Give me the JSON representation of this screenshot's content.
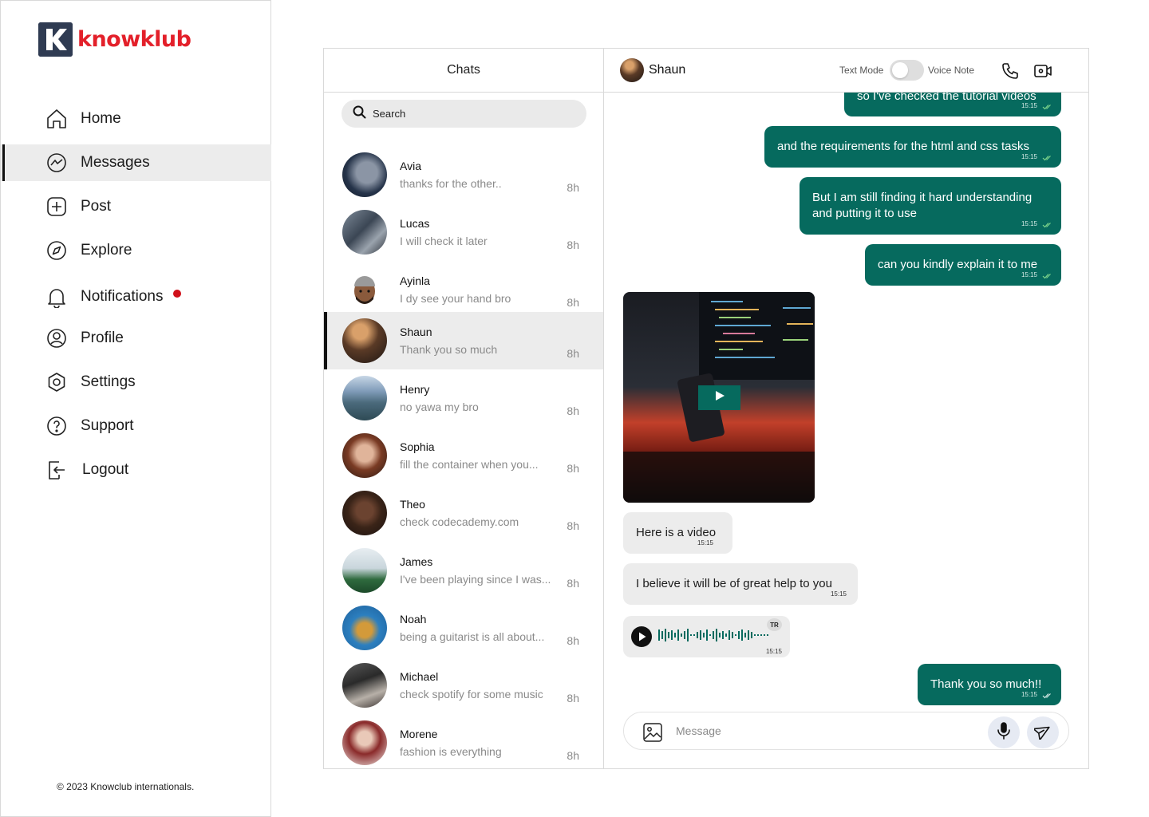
{
  "brand": {
    "name": "knowklub",
    "accent": "#e3202a",
    "mark_color": "#2f3b52"
  },
  "nav": {
    "items": [
      {
        "label": "Home",
        "icon": "home-icon"
      },
      {
        "label": "Messages",
        "icon": "messenger-icon",
        "active": true
      },
      {
        "label": "Post",
        "icon": "plus-square-icon"
      },
      {
        "label": "Explore",
        "icon": "compass-icon"
      },
      {
        "label": "Notifications",
        "icon": "bell-icon",
        "has_dot": true
      },
      {
        "label": "Profile",
        "icon": "user-circle-icon"
      },
      {
        "label": "Settings",
        "icon": "gear-icon"
      },
      {
        "label": "Support",
        "icon": "help-circle-icon"
      },
      {
        "label": "Logout",
        "icon": "logout-icon"
      }
    ]
  },
  "footer": {
    "copyright": "© 2023 Knowclub internationals."
  },
  "chats": {
    "title": "Chats",
    "search_placeholder": "Search",
    "items": [
      {
        "name": "Avia",
        "preview": "thanks for the other..",
        "time": "8h"
      },
      {
        "name": "Lucas",
        "preview": "I will check it later",
        "time": "8h"
      },
      {
        "name": "Ayinla",
        "preview": "I dy see your hand bro",
        "time": "8h"
      },
      {
        "name": "Shaun",
        "preview": "Thank you so much",
        "time": "8h",
        "active": true
      },
      {
        "name": "Henry",
        "preview": "no yawa my bro",
        "time": "8h"
      },
      {
        "name": "Sophia",
        "preview": "fill the container when you...",
        "time": "8h"
      },
      {
        "name": "Theo",
        "preview": "check codecademy.com",
        "time": "8h"
      },
      {
        "name": "James",
        "preview": "I've been playing since I was...",
        "time": "8h"
      },
      {
        "name": "Noah",
        "preview": "being a guitarist is all about...",
        "time": "8h"
      },
      {
        "name": "Michael",
        "preview": "check spotify for some music",
        "time": "8h"
      },
      {
        "name": "Morene",
        "preview": "fashion is everything",
        "time": "8h"
      }
    ]
  },
  "conversation": {
    "contact_name": "Shaun",
    "mode_left": "Text Mode",
    "mode_right": "Voice Note",
    "accent": "#066a5e",
    "messages": [
      {
        "dir": "out",
        "text": "so I've checked the tutorial videos",
        "time": "15:15"
      },
      {
        "dir": "out",
        "text": "and the requirements for the html and css tasks",
        "time": "15:15"
      },
      {
        "dir": "out",
        "text": "But I am still finding it hard understanding and putting it to use",
        "time": "15:15"
      },
      {
        "dir": "out",
        "text": "can you kindly explain it to me",
        "time": "15:15"
      },
      {
        "dir": "in",
        "text": "Here is a video",
        "time": "15:15"
      },
      {
        "dir": "in",
        "text": "I believe it will be of great help to you",
        "time": "15:15"
      },
      {
        "dir": "out",
        "text": "Thank you so much!!",
        "time": "15:15"
      }
    ],
    "voice_note": {
      "time": "15:15",
      "badge": "TR"
    },
    "composer_placeholder": "Message"
  }
}
